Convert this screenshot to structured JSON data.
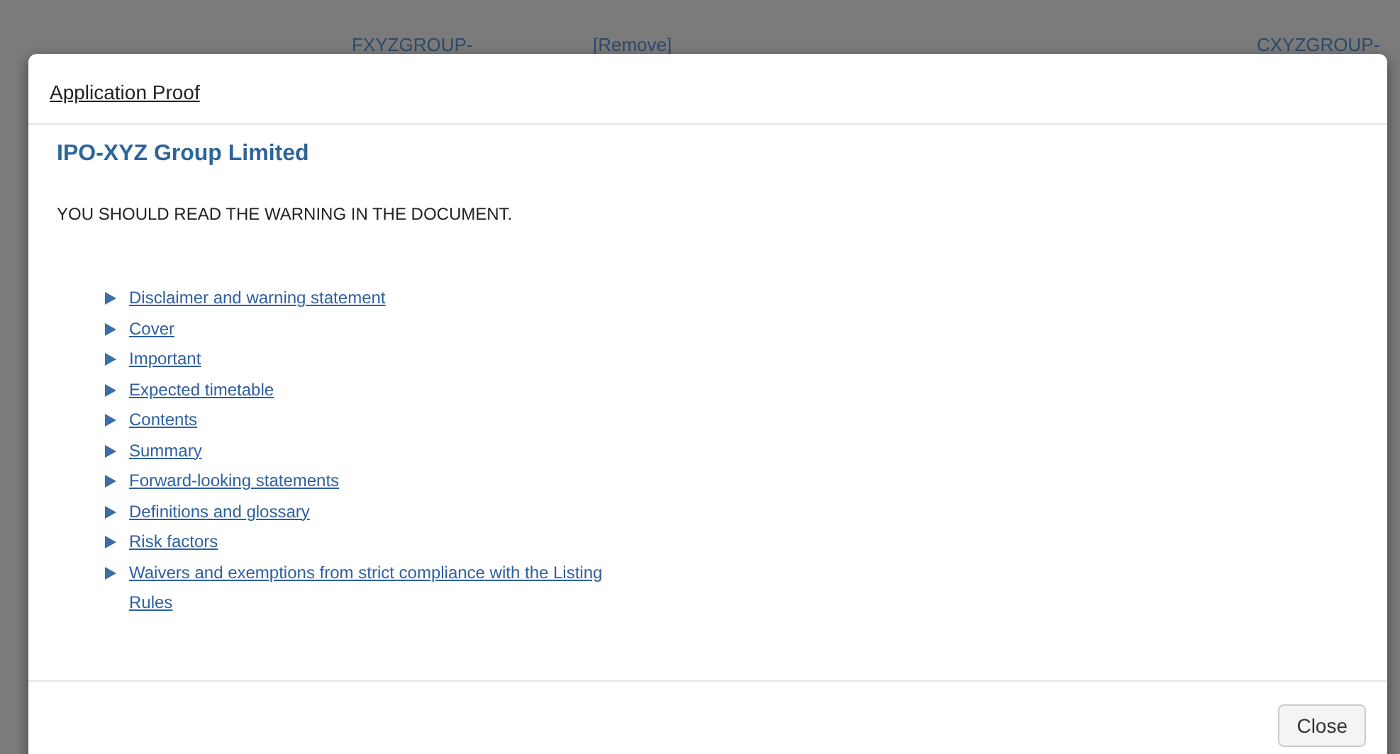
{
  "background": {
    "texts": [
      "FXYZGROUP-",
      "[Remove]",
      "CXYZGROUP-"
    ]
  },
  "modal": {
    "title": "Application Proof",
    "company": "IPO-XYZ Group Limited",
    "warning": "YOU SHOULD READ THE WARNING IN THE DOCUMENT.",
    "links": [
      {
        "label": "Disclaimer and warning statement"
      },
      {
        "label": "Cover"
      },
      {
        "label": "Important"
      },
      {
        "label": "Expected timetable"
      },
      {
        "label": "Contents"
      },
      {
        "label": "Summary"
      },
      {
        "label": "Forward-looking statements"
      },
      {
        "label": "Definitions and glossary"
      },
      {
        "label": "Risk factors"
      },
      {
        "label": "Waivers and exemptions from strict compliance with the Listing Rules"
      }
    ],
    "close_button": "Close"
  }
}
